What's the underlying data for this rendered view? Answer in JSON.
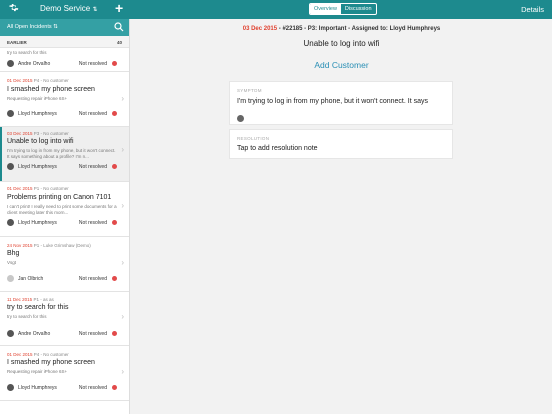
{
  "topbar": {
    "service_label": "Demo Service",
    "segment": {
      "overview": "Overview",
      "discussion": "Discussion",
      "active": "overview"
    },
    "details_label": "Details",
    "bg_color": "#1d8a8e"
  },
  "sidebar": {
    "filter_label": "All Open Incidents",
    "section": {
      "title": "EARLIER",
      "count": "40"
    },
    "items": [
      {
        "date": "",
        "meta_rest": "",
        "title": "",
        "desc": "try to search for this",
        "agent": "Andre Orvalho",
        "status": "Not resolved"
      },
      {
        "date": "01 Dec 2015",
        "meta_rest": " P4 - No customer",
        "title": "I smashed my phone screen",
        "desc": "Requesting repair iPhone 6S+",
        "agent": "Lloyd Humphreys",
        "status": "Not resolved"
      },
      {
        "date": "03 Dec 2015",
        "meta_rest": " P3 - No customer",
        "title": "Unable to log into wifi",
        "desc": "I'm trying to log in from my phone, but it won't connect. It says something about a profile? I'm n...",
        "agent": "Lloyd Humphreys",
        "status": "Not resolved"
      },
      {
        "date": "01 Dec 2015",
        "meta_rest": " P1 - No customer",
        "title": "Problems printing on Canon 7101",
        "desc": "I can't print! I really need to print some documents for a client meeting later this morn...",
        "agent": "Lloyd Humphreys",
        "status": "Not resolved"
      },
      {
        "date": "24 Nov 2015",
        "meta_rest": " P1 - Luke Grimshaw (Demo)",
        "title": "Bhg",
        "desc": "Vsgt",
        "agent": "Jan Olbrich",
        "status": "Not resolved"
      },
      {
        "date": "11 Dec 2015",
        "meta_rest": " P1 - as as",
        "title": "try to search for this",
        "desc": "try to search for this",
        "agent": "Andre Orvalho",
        "status": "Not resolved"
      },
      {
        "date": "01 Dec 2015",
        "meta_rest": " P4 - No customer",
        "title": "I smashed my phone screen",
        "desc": "Requesting repair iPhone 6S+",
        "agent": "Lloyd Humphreys",
        "status": "Not resolved"
      }
    ]
  },
  "main": {
    "date": "03 Dec 2015",
    "header_rest": " - #22185 - P3: Important - Assigned to: Lloyd Humphreys",
    "title": "Unable to log into wifi",
    "add_customer": "Add Customer",
    "symptom": {
      "caption": "SYMPTOM",
      "text": "I'm trying to log in from my phone, but it won't connect. It says"
    },
    "resolution": {
      "caption": "RESOLUTION",
      "text": "Tap to add resolution note"
    }
  }
}
